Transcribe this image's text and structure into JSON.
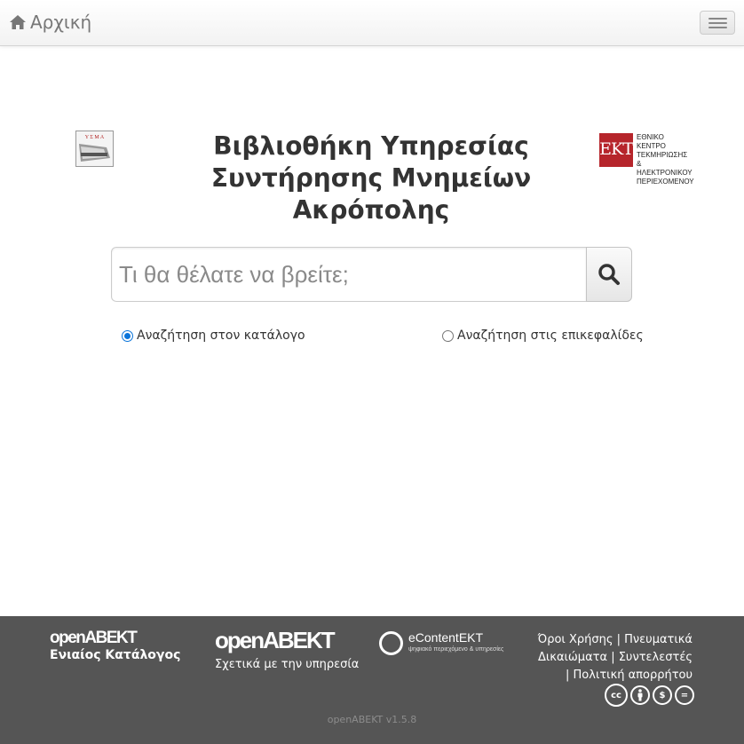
{
  "navbar": {
    "brand_label": "Αρχική",
    "home_icon": "home-icon",
    "menu_icon": "hamburger-menu-icon"
  },
  "main": {
    "title_lines": [
      "Βιβλιοθήκη Υπηρεσίας",
      "Συντήρησης Μνημείων",
      "Ακρόπολης"
    ],
    "logo_left_text": "Υ Σ Μ Α",
    "logo_right": {
      "mark": "ΕΚΤ",
      "lines": [
        "ΕΘΝΙΚΟ ΚΕΝΤΡΟ",
        "ΤΕΚΜΗΡΙΩΣΗΣ &",
        "ΗΛΕΚΤΡΟΝΙΚΟΥ",
        "ΠΕΡΙΕΧΟΜΕΝΟΥ"
      ]
    },
    "search": {
      "placeholder": "Τι θα θέλατε να βρείτε;",
      "value": "",
      "button_icon": "search-icon"
    },
    "radios": [
      {
        "label": "Αναζήτηση στον κατάλογο",
        "checked": true
      },
      {
        "label": "Αναζήτηση στις επικεφαλίδες",
        "checked": false
      }
    ],
    "accent_color": "#0a74da"
  },
  "footer": {
    "brand1": "openABEKT",
    "brand1_sub": "Ενιαίος Κατάλογος",
    "brand2": "openABEKT",
    "brand2_sub": "Σχετικά με την υπηρεσία",
    "econtent_name": "eContentEKT",
    "econtent_tag": "ψηφιακό περιεχόμενο & υπηρεσίες",
    "links": [
      "Όροι Χρήσης",
      "Πνευματικά Δικαιώματα",
      "Συντελεστές",
      "Πολιτική απορρήτου"
    ],
    "license_icons": [
      "cc-icon",
      "by-icon",
      "nc-icon",
      "nd-icon"
    ],
    "version": "openABEKT v1.5.8",
    "background_color": "#555555"
  }
}
